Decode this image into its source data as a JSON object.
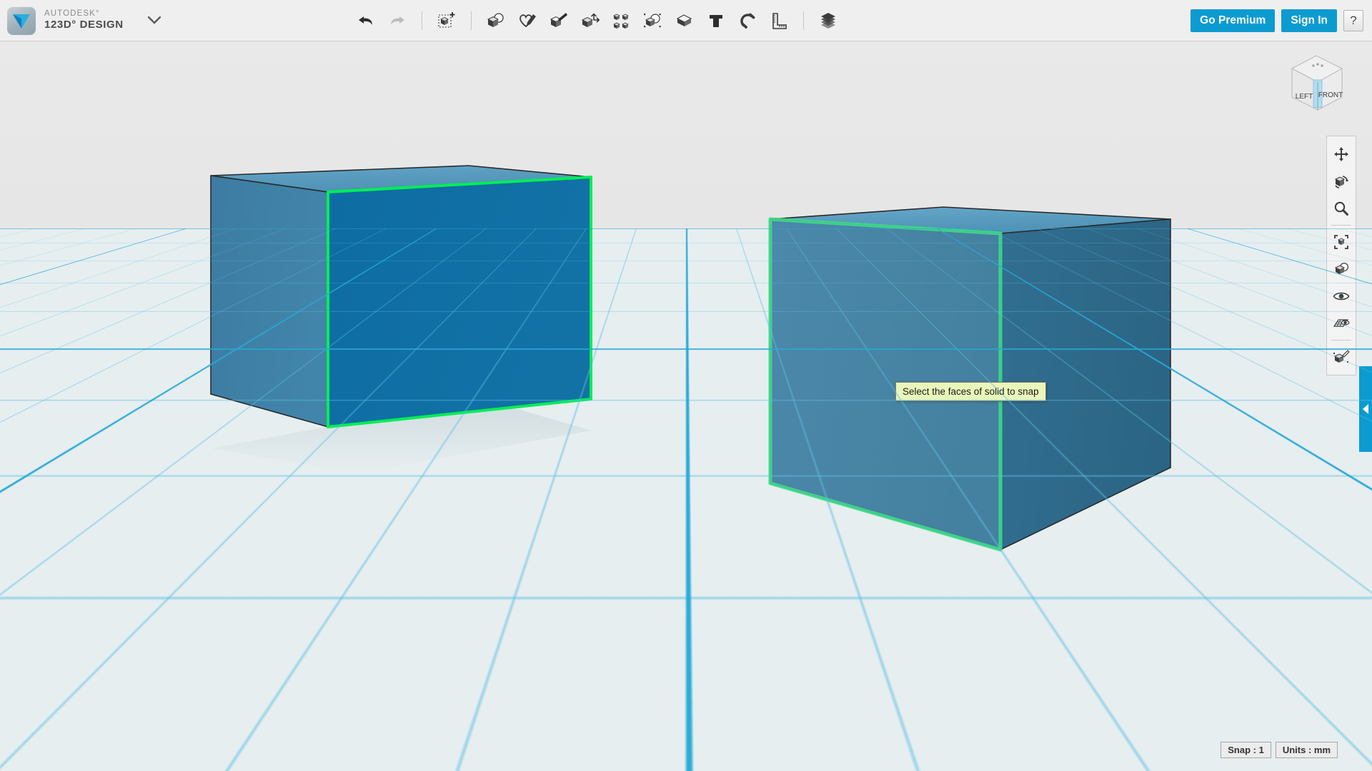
{
  "app": {
    "brand_top": "AUTODESK°",
    "brand_main": "123D° DESIGN",
    "logo_icon": "autodesk-123d-logo"
  },
  "toolbar": {
    "history": [
      {
        "name": "undo-button",
        "icon": "undo-arrow-icon",
        "label": "Undo",
        "enabled": true
      },
      {
        "name": "redo-button",
        "icon": "redo-arrow-icon",
        "label": "Redo",
        "enabled": false
      }
    ],
    "transform": [
      {
        "name": "transform-button",
        "icon": "transform-move-cube-icon",
        "label": "Transform"
      }
    ],
    "tools": [
      {
        "name": "primitives-button",
        "icon": "primitives-cube-sphere-icon",
        "label": "Primitives"
      },
      {
        "name": "sketch-button",
        "icon": "sketch-pencil-icon",
        "label": "Sketch"
      },
      {
        "name": "construct-button",
        "icon": "construct-extrude-icon",
        "label": "Construct"
      },
      {
        "name": "modify-button",
        "icon": "modify-axis-cube-icon",
        "label": "Modify"
      },
      {
        "name": "pattern-button",
        "icon": "pattern-grid-cubes-icon",
        "label": "Pattern"
      },
      {
        "name": "combine-button",
        "icon": "combine-boolean-icon",
        "label": "Combine"
      },
      {
        "name": "group-button",
        "icon": "group-solid-icon",
        "label": "Group"
      },
      {
        "name": "text-button",
        "icon": "text-t-icon",
        "label": "Text"
      },
      {
        "name": "snap-button",
        "icon": "snap-magnet-icon",
        "label": "Snap"
      },
      {
        "name": "measure-button",
        "icon": "measure-ruler-icon",
        "label": "Measure"
      }
    ],
    "materials": [
      {
        "name": "material-button",
        "icon": "material-layers-icon",
        "label": "Material"
      }
    ]
  },
  "account": {
    "go_premium": "Go Premium",
    "sign_in": "Sign In",
    "help": "?",
    "help_icon": "question-mark-icon",
    "accent_color": "#0c9bd0"
  },
  "viewcube": {
    "name": "view-cube",
    "faces": {
      "left": "LEFT",
      "front": "FRONT"
    },
    "highlight_color": "#b3dcef"
  },
  "navbar": {
    "items": [
      {
        "name": "pan-tool",
        "icon": "pan-four-arrows-icon",
        "label": "Pan"
      },
      {
        "name": "orbit-tool",
        "icon": "orbit-cube-rotate-icon",
        "label": "Orbit"
      },
      {
        "name": "zoom-tool",
        "icon": "zoom-magnifier-icon",
        "label": "Zoom"
      },
      {
        "name": "fit-tool",
        "icon": "fit-to-view-brackets-icon",
        "label": "Fit"
      },
      {
        "name": "object-view-tool",
        "icon": "object-visibility-cube-icon",
        "label": "Object Visibility"
      },
      {
        "name": "show-hide-tool",
        "icon": "eye-icon",
        "label": "Show / Hide"
      },
      {
        "name": "grid-snap-tool",
        "icon": "grid-eye-icon",
        "label": "Grid / Snap Display"
      },
      {
        "name": "material-tool",
        "icon": "material-brush-cube-icon",
        "label": "Material"
      }
    ]
  },
  "edge_panel": {
    "name": "right-panel-handle",
    "icon": "chevron-left-icon",
    "color": "#0c9bd0"
  },
  "tooltip": {
    "text": "Select the faces of solid to snap"
  },
  "status": {
    "snap": "Snap : 1",
    "units": "Units : mm"
  },
  "scene": {
    "background_color": "#e7e7e7",
    "ground_color": "#e6eef0",
    "grid_minor_color": "#5abee1",
    "grid_major_color": "#26a8d6",
    "selection_color": "#00ee55",
    "objects": [
      {
        "name": "cube-left",
        "selected_face": "front",
        "face_colors": {
          "top": "#5a9cc0",
          "left": "#3e7fa4",
          "front": "#0f6ea4"
        },
        "highlight_color": "#00ee55"
      },
      {
        "name": "cube-right",
        "selected_face": "front-left",
        "face_colors": {
          "top": "#5a9cc0",
          "front": "#4a86a8",
          "right": "#2e6a8c"
        },
        "highlight_color": "#3fd98a"
      }
    ]
  }
}
